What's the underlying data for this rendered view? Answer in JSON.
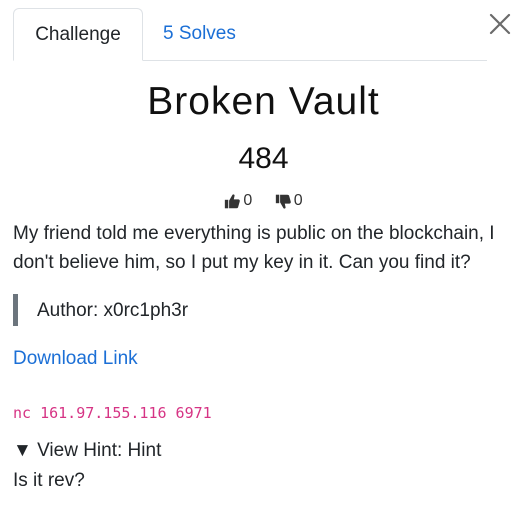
{
  "tabs": {
    "challenge_label": "Challenge",
    "solves_label": "5 Solves"
  },
  "close_icon": "close-icon",
  "challenge": {
    "name": "Broken Vault",
    "points": "484",
    "upvotes": "0",
    "downvotes": "0",
    "description": "My friend told me everything is public on the blockchain, I don't believe him, so I put my key in it. Can you find it?",
    "author": "Author: x0rc1ph3r",
    "download_label": "Download Link",
    "connection": "nc 161.97.155.116 6971"
  },
  "hint": {
    "summary_marker": "▼",
    "summary_label": "View Hint: Hint",
    "content": "Is it rev?"
  },
  "colors": {
    "link": "#1b6fd6",
    "code": "#d63384",
    "quote_border": "#6c757d"
  }
}
